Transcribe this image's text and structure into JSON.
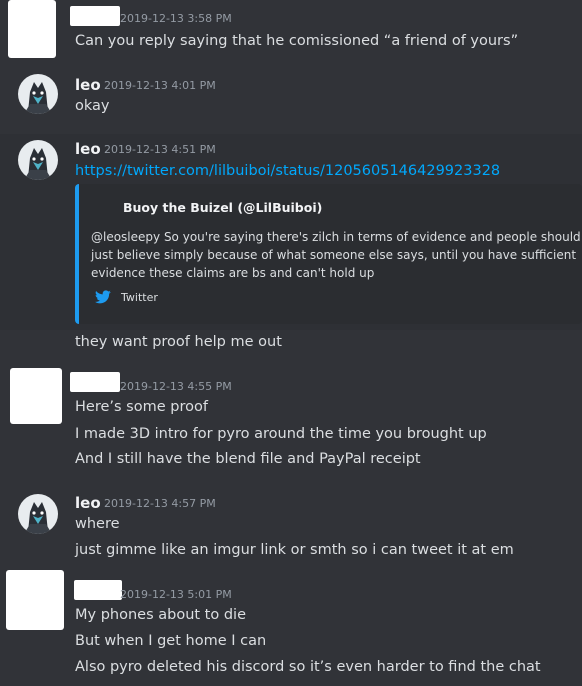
{
  "messages": [
    {
      "author": "",
      "timestamp": "2019-12-13 3:58 PM",
      "lines": [
        "Can you reply saying that he comissioned “a friend of yours”"
      ]
    },
    {
      "author": "leo",
      "timestamp": "2019-12-13 4:01 PM",
      "lines": [
        "okay"
      ]
    },
    {
      "author": "leo",
      "timestamp": "2019-12-13 4:51 PM",
      "link": "https://twitter.com/lilbuiboi/status/1205605146429923328",
      "embed": {
        "author": "Buoy the Buizel (@LilBuiboi)",
        "description_lines": [
          "@leosleepy So you're saying there's zilch in terms of evidence and people should",
          "just believe simply because of what someone else says, until you have sufficient",
          "evidence these claims are bs and can't hold up"
        ],
        "footer": "Twitter",
        "footer_icon": "twitter-bird-icon",
        "accent_color": "#1d9bf0"
      },
      "after_lines": [
        "they want proof help me out"
      ]
    },
    {
      "author": "",
      "timestamp": "2019-12-13 4:55 PM",
      "lines": [
        "Here’s some proof",
        "I made 3D intro for pyro around the time you brought up",
        "And I still have the blend file and PayPal receipt"
      ]
    },
    {
      "author": "leo",
      "timestamp": "2019-12-13 4:57 PM",
      "lines": [
        "where",
        "just gimme like an imgur link or smth so i can tweet it at em"
      ]
    },
    {
      "author": "",
      "timestamp": "2019-12-13 5:01 PM",
      "lines": [
        "My phones about to die",
        "But when I get home I can",
        "Also pyro deleted his discord so it’s even harder to find the chat"
      ]
    }
  ],
  "colors": {
    "background": "#313338",
    "text": "#dbdee1",
    "timestamp": "#949ba4",
    "link": "#00a8fc",
    "twitter": "#1d9bf0"
  }
}
